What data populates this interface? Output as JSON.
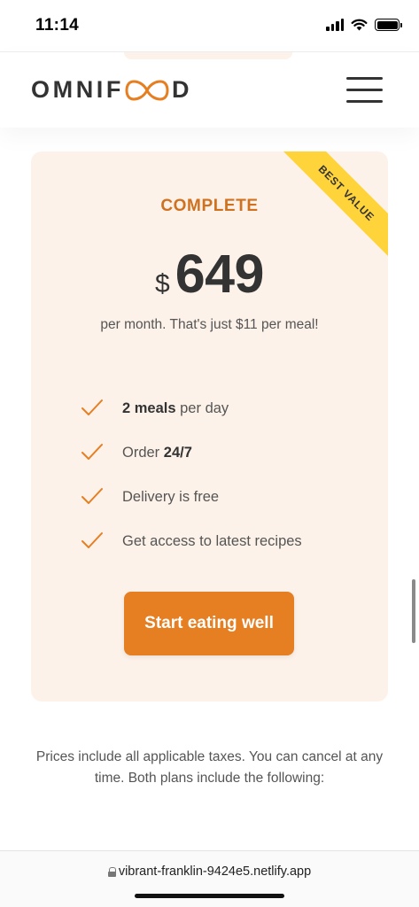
{
  "status_bar": {
    "time": "11:14"
  },
  "header": {
    "logo_left": "OMNIF",
    "logo_right": "D",
    "logo_icon": "infinity-oo-icon",
    "menu_icon": "hamburger-menu-icon"
  },
  "plan": {
    "badge": "BEST VALUE",
    "name": "COMPLETE",
    "currency": "$",
    "price": "649",
    "subtext": "per month. That's just $11 per meal!",
    "features": [
      {
        "bold": "2 meals",
        "rest": " per day",
        "bold_first": true
      },
      {
        "before": "Order ",
        "bold": "24/7"
      },
      {
        "text": "Delivery is free"
      },
      {
        "text": "Get access to latest recipes"
      }
    ],
    "cta": "Start eating well"
  },
  "plan_details": "Prices include all applicable taxes. You can cancel at any time. Both plans include the following:",
  "browser": {
    "url": "vibrant-franklin-9424e5.netlify.app"
  },
  "colors": {
    "accent": "#e67e22",
    "accent_dark": "#cf711f",
    "card_bg": "#fdf2e9",
    "badge_bg": "#ffd43b",
    "text": "#333333"
  }
}
